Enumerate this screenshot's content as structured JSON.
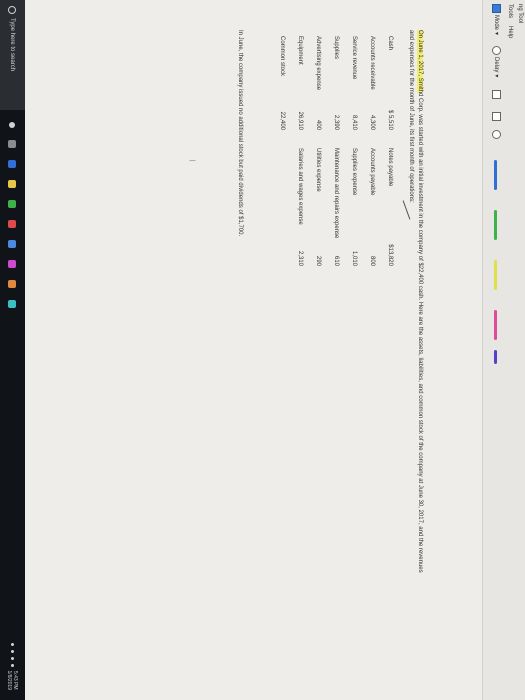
{
  "window": {
    "title": "ng Tool",
    "menu": {
      "tools": "Tools",
      "help": "Help"
    },
    "toolbar": {
      "mode_label": "Mode",
      "delay_label": "Delay"
    }
  },
  "document": {
    "intro_highlight": "On June 1, 2017, Smith",
    "intro_rest": "d Corp. was started with an initial investment in the company of $22,400 cash. Here are the assets, liabilities, and common stock of the company at June 30, 2017, and the revenues",
    "intro_line2": "and expenses for the month of June, its first month of operations:",
    "left_items": [
      {
        "label": "Cash",
        "value": "$ 5,510"
      },
      {
        "label": "Accounts receivable",
        "value": "4,300"
      },
      {
        "label": "Service revenue",
        "value": "8,410"
      },
      {
        "label": "Supplies",
        "value": "2,390"
      },
      {
        "label": "Advertising expense",
        "value": "400"
      },
      {
        "label": "Equipment",
        "value": "26,910"
      },
      {
        "label": "Common stock",
        "value": "22,400"
      }
    ],
    "right_items": [
      {
        "label": "Notes payable",
        "value": "$13,820"
      },
      {
        "label": "Accounts payable",
        "value": "800"
      },
      {
        "label": "Supplies expense",
        "value": "1,010"
      },
      {
        "label": "Maintenance and repairs expense",
        "value": "610"
      },
      {
        "label": "Utilities expense",
        "value": "290"
      },
      {
        "label": "Salaries and wages expense",
        "value": "2,310"
      }
    ],
    "note": "In June, the company issued no additional stock but paid dividends of $1,700."
  },
  "taskbar": {
    "search_placeholder": "Type here to search",
    "tray_time": "5:43 PM",
    "tray_date": "1/8/2019"
  },
  "colors": {
    "highlight": "#f2ed70",
    "taskbar": "#101317",
    "screen": "#eeede9"
  }
}
